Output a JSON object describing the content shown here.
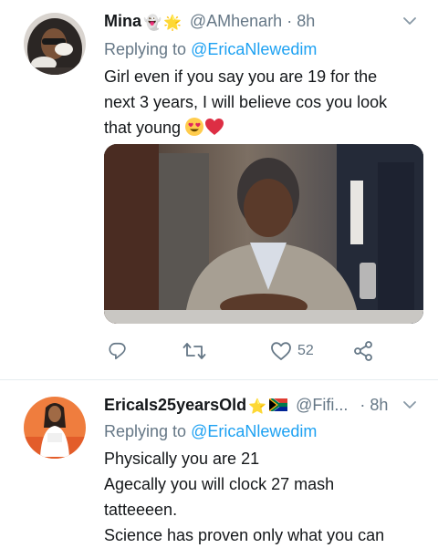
{
  "tweets": [
    {
      "name": "Mina",
      "name_emojis": [
        "👻",
        "🌟"
      ],
      "handle": "@AMhenarh",
      "separator": "·",
      "time": "8h",
      "replying_prefix": "Replying to ",
      "replying_to": "@EricaNlewedim",
      "body_lines": [
        "Girl even if you say you are 19 for the",
        "next 3 years, I will believe cos you look",
        "that young"
      ],
      "body_emojis": [
        "😍",
        "❤️"
      ],
      "actions": {
        "reply_count": "",
        "retweet_count": "",
        "like_count": "52"
      }
    },
    {
      "name": "EricaIs25yearsOld",
      "name_emojis": [
        "⭐",
        "🇿🇦"
      ],
      "handle": "@Fifi...",
      "separator": "·",
      "time": "8h",
      "replying_prefix": "Replying to ",
      "replying_to": "@EricaNlewedim",
      "body_lines": [
        "Physically you are 21",
        "Agecally you will clock 27 mash",
        "tatteeeen.",
        "Science has proven only what you can"
      ]
    }
  ],
  "colors": {
    "text": "#14171a",
    "secondary": "#657786",
    "link": "#1da1f2",
    "divider": "#e6ecf0"
  },
  "icons": [
    "more-chevron-icon",
    "reply-icon",
    "retweet-icon",
    "like-icon",
    "share-icon"
  ]
}
